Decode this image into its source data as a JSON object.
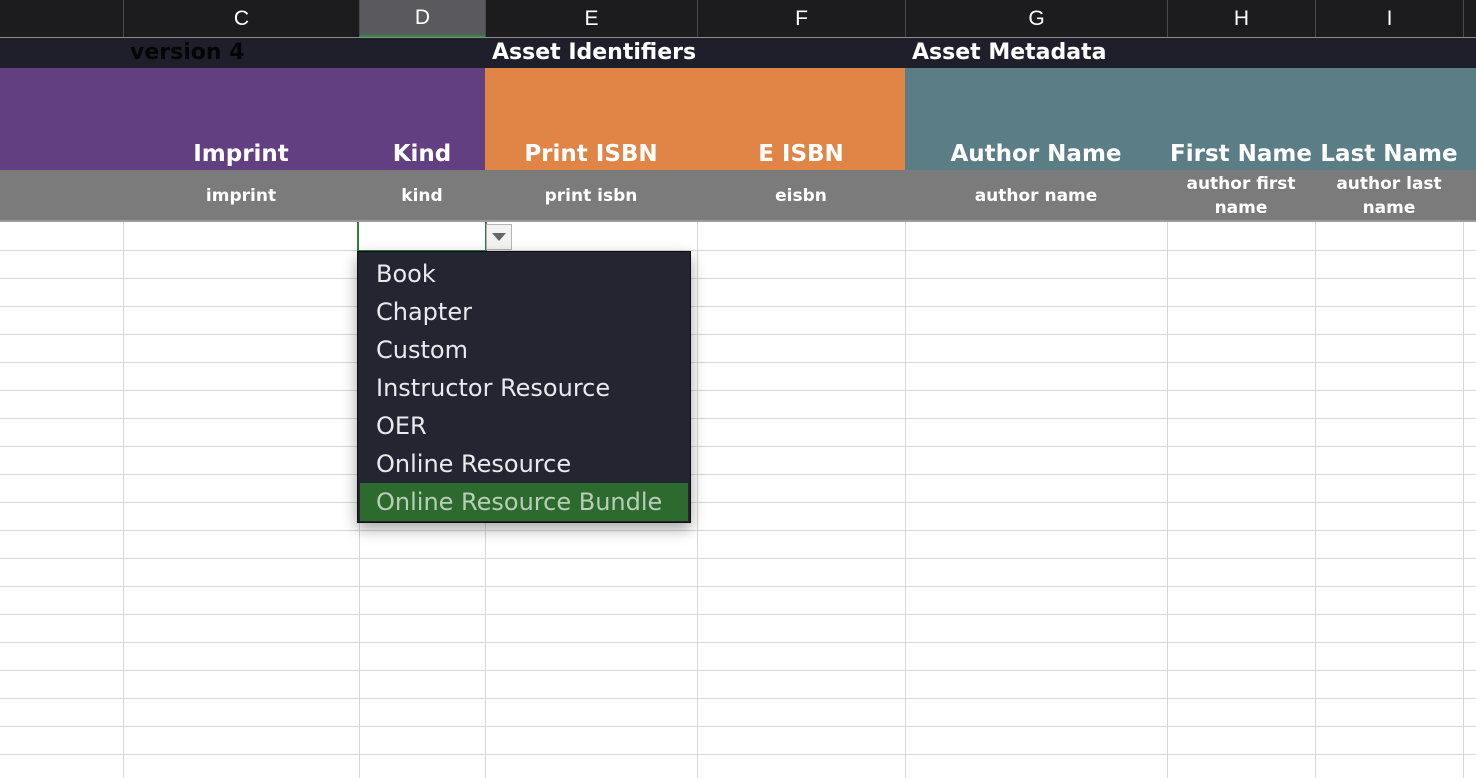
{
  "columns": {
    "c": "C",
    "d": "D",
    "e": "E",
    "f": "F",
    "g": "G",
    "h": "H",
    "i": "I"
  },
  "sheet": {
    "version_label": "version 4",
    "section_identifiers": "Asset Identifiers",
    "section_metadata": "Asset Metadata"
  },
  "field_titles": {
    "imprint": "Imprint",
    "kind": "Kind",
    "print_isbn": "Print ISBN",
    "e_isbn": "E ISBN",
    "author_name": "Author Name",
    "first_name": "First Name",
    "last_name": "Last Name"
  },
  "field_keys": {
    "imprint": "imprint",
    "kind": "kind",
    "print_isbn": "print isbn",
    "eisbn": "eisbn",
    "author_name": "author name",
    "author_first_name": "author first name",
    "author_last_name": "author last name"
  },
  "dropdown": {
    "options": [
      "Book",
      "Chapter",
      "Custom",
      "Instructor Resource",
      "OER",
      "Online Resource",
      "Online Resource Bundle"
    ],
    "highlighted": "Online Resource Bundle"
  },
  "colors": {
    "imprint_kind_header": "#623f80",
    "identifiers_header": "#e18546",
    "metadata_header": "#5b7d86",
    "key_row": "#7b7b7b",
    "selection_accent": "#2e7d3e"
  }
}
